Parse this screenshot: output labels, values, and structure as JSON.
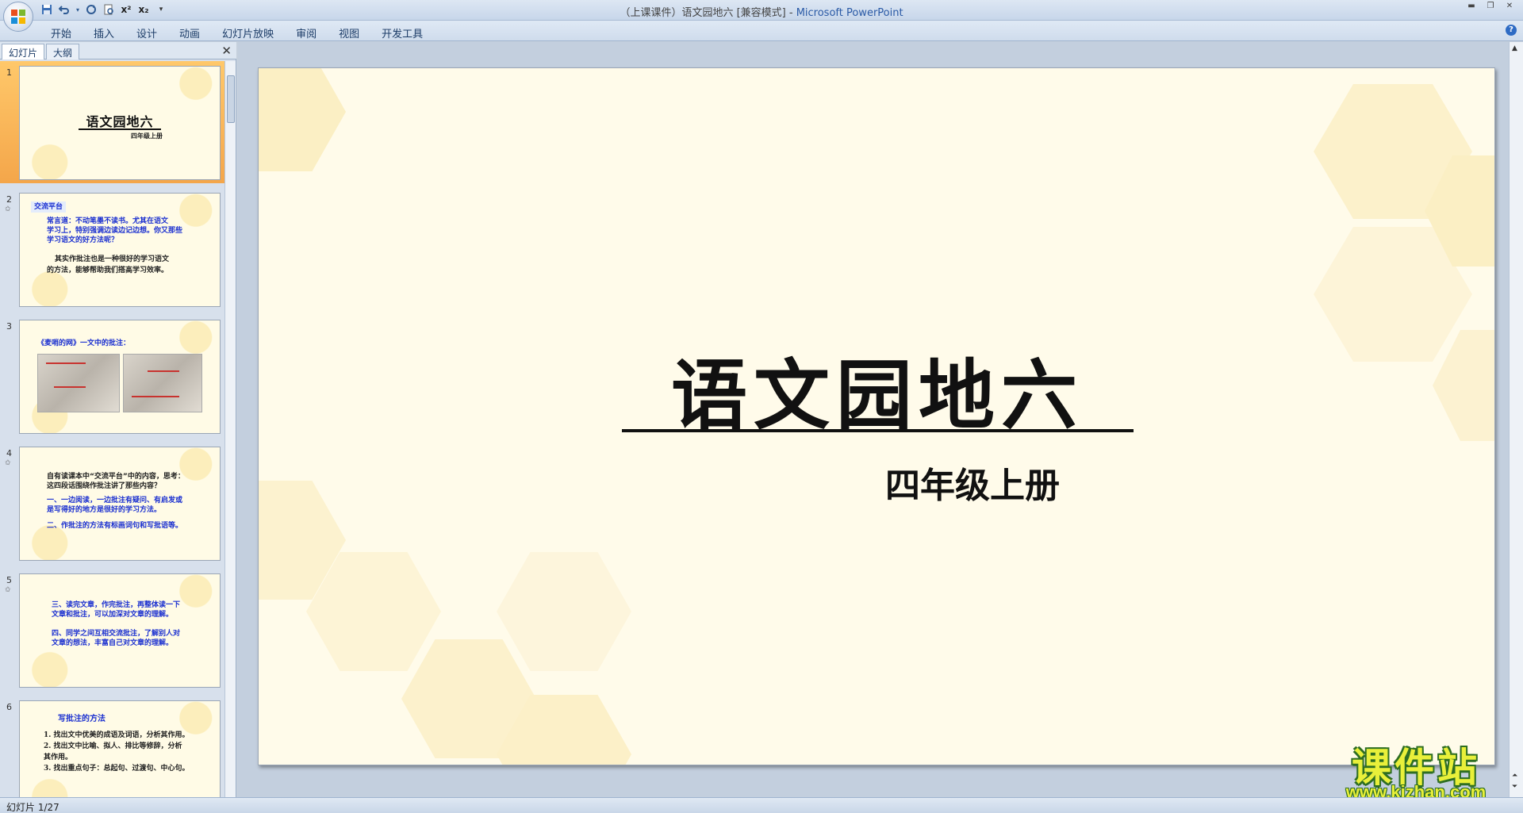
{
  "window": {
    "doc_title": "（上课课件）语文园地六 [兼容模式]",
    "app_name": "Microsoft PowerPoint",
    "separator": " - "
  },
  "qat": {
    "save_icon": "save-icon",
    "undo_icon": "undo-icon",
    "redo_icon": "redo-icon",
    "preview_icon": "print-preview-icon",
    "superscript": "x²",
    "subscript": "x₂",
    "customize": "▾"
  },
  "ribbon": {
    "tabs": [
      "开始",
      "插入",
      "设计",
      "动画",
      "幻灯片放映",
      "审阅",
      "视图",
      "开发工具"
    ],
    "help": "?"
  },
  "pane": {
    "tab_slides": "幻灯片",
    "tab_outline": "大纲",
    "close": "✕"
  },
  "thumbnails": [
    {
      "num": "1",
      "title": "语文园地六",
      "subtitle": "四年级上册"
    },
    {
      "num": "2",
      "heading": "交流平台",
      "lines": [
        "常言道：不动笔墨不读书。尤其在语文",
        "学习上，特别强调边读边记边想。你又那些",
        "学习语文的好方法呢？"
      ],
      "lines2": [
        "其实作批注也是一种很好的学习语文",
        "的方法，能够帮助我们搭高学习效率。"
      ]
    },
    {
      "num": "3",
      "heading": "《麦哨的网》一文中的批注："
    },
    {
      "num": "4",
      "lines": [
        "自有读课本中“交流平台”中的内容，思考：",
        "这四段话围绕作批注讲了那些内容？"
      ],
      "lines2": [
        "一、一边阅读，一边批注有疑问、有启发或",
        "是写得好的地方是很好的学习方法。"
      ],
      "lines3": [
        "二、作批注的方法有标画词句和写批语等。"
      ]
    },
    {
      "num": "5",
      "lines": [
        "三、读完文章，作完批注，再整体读一下",
        "文章和批注，可以加深对文章的理解。"
      ],
      "lines2": [
        "四、同学之间互相交流批注，了解别人对",
        "文章的想法，丰富自己对文章的理解。"
      ]
    },
    {
      "num": "6",
      "heading": "写批注的方法",
      "lines": [
        "1. 找出文中优美的成语及词语，分析其作用。",
        "2. 找出文中比喻、拟人、排比等修辞，分析",
        "其作用。",
        "3. 找出重点句子：总起句、过渡句、中心句。"
      ]
    }
  ],
  "slide": {
    "title": "语文园地六",
    "subtitle": "四年级上册"
  },
  "status": {
    "text": "幻灯片 1/27"
  },
  "watermark": {
    "top": "课件站",
    "bottom": "www.kjzhan.com"
  },
  "colors": {
    "slide_bg": "#fffbea",
    "hex_fill": "#fbefc4",
    "thumb_text_blue": "#1a2fd0",
    "selected_thumb": "#f4a64a"
  }
}
